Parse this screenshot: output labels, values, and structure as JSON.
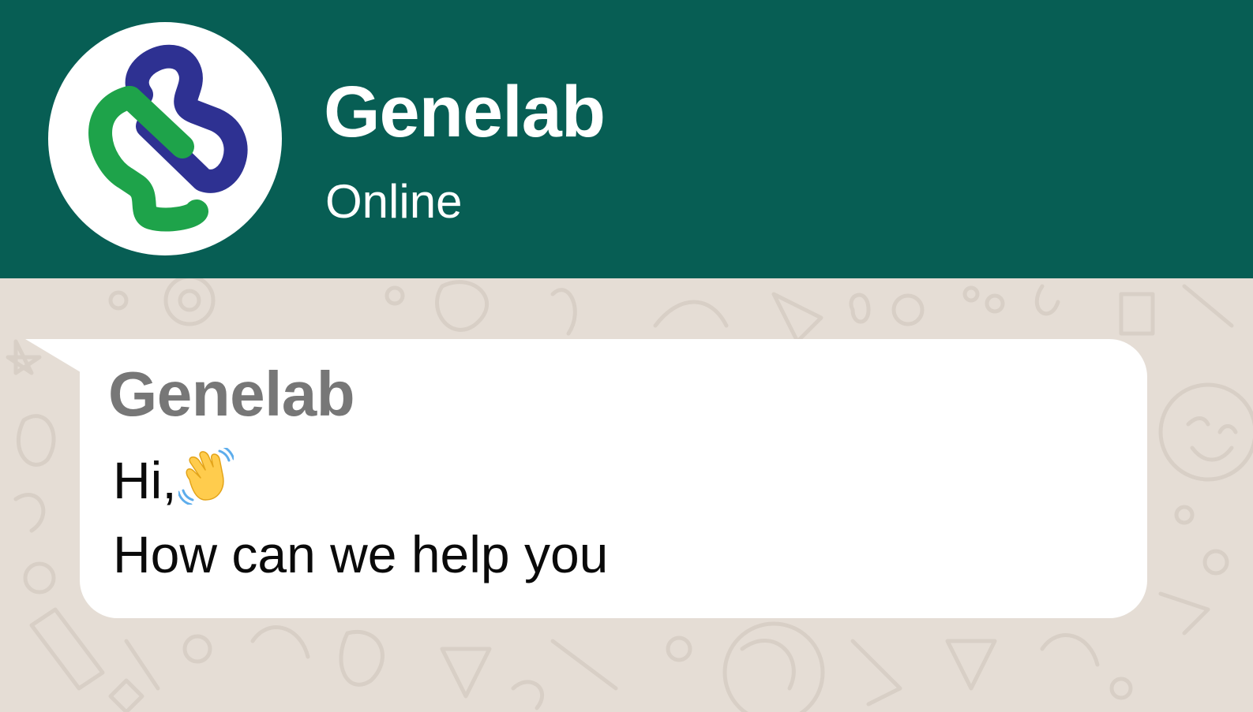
{
  "header": {
    "contact_name": "Genelab",
    "status": "Online",
    "avatar_icon": "genelab-logo-icon",
    "background_color": "#075e54"
  },
  "chat": {
    "wallpaper_color": "#e5ddd5",
    "message": {
      "sender": "Genelab",
      "line1": "Hi,",
      "line1_icon": "waving-hand-icon",
      "line2": "How can we help you"
    }
  },
  "colors": {
    "logo_blue": "#2e3192",
    "logo_green": "#1ea34a"
  }
}
